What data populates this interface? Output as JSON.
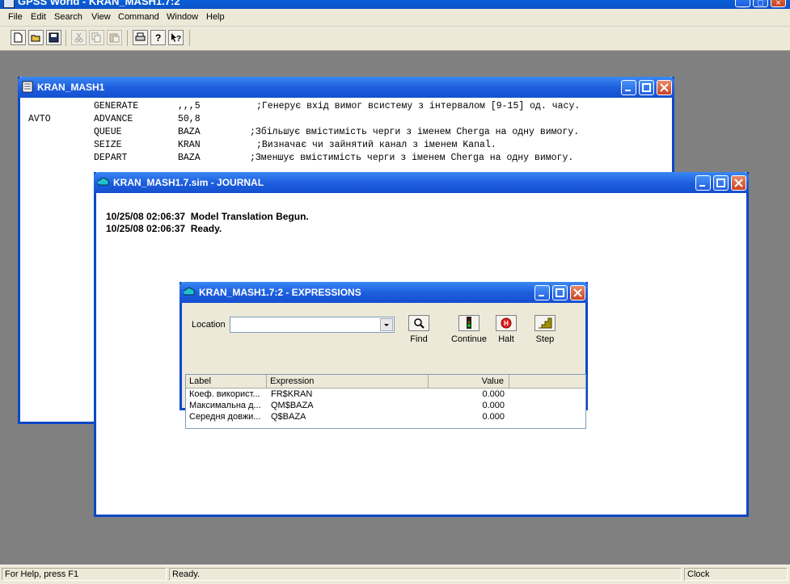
{
  "app": {
    "title": "GPSS World - KRAN_MASH1.7:2",
    "menu": [
      "File",
      "Edit",
      "Search",
      "View",
      "Command",
      "Window",
      "Help"
    ]
  },
  "model_window": {
    "title": "KRAN_MASH1",
    "lines": [
      {
        "label": "",
        "op": "GENERATE",
        "operand": ",,,5",
        "comment": ";Генерує вхід вимог всистему з інтервалом [9-15] од. часу."
      },
      {
        "label": "AVTO",
        "op": "ADVANCE",
        "operand": "50,8",
        "comment": ""
      },
      {
        "label": "",
        "op": "QUEUE",
        "operand": "BAZA",
        "comment": ";Збільшує вмістимість черги з іменем Cherga на одну вимогу."
      },
      {
        "label": "",
        "op": "SEIZE",
        "operand": "KRAN",
        "comment": ";Визначає чи зайнятий канал з іменем Kanal."
      },
      {
        "label": "",
        "op": "DEPART",
        "operand": "BAZA",
        "comment": ";Зменшує вмістимість черги з іменем Cherga на одну вимогу."
      }
    ]
  },
  "journal_window": {
    "title": "KRAN_MASH1.7.sim  -  JOURNAL",
    "lines": [
      "10/25/08 02:06:37  Model Translation Begun.",
      "10/25/08 02:06:37  Ready."
    ]
  },
  "expressions_window": {
    "title": "KRAN_MASH1.7:2  -  EXPRESSIONS",
    "location_label": "Location",
    "location_value": "",
    "buttons": {
      "find": "Find",
      "continue": "Continue",
      "halt": "Halt",
      "step": "Step"
    },
    "columns": [
      "Label",
      "Expression",
      "Value"
    ],
    "rows": [
      {
        "label": "Коеф. використ...",
        "expression": "FR$KRAN",
        "value": "0.000"
      },
      {
        "label": "Максимальна д...",
        "expression": "QM$BAZA",
        "value": "0.000"
      },
      {
        "label": "Середня довжи...",
        "expression": "Q$BAZA",
        "value": "0.000"
      }
    ]
  },
  "status": {
    "help": "For Help, press F1",
    "state": "Ready.",
    "clock": "Clock"
  },
  "colors": {
    "titlebar": "#0a48c8",
    "chrome": "#ece9d8",
    "workspace": "#808080"
  }
}
